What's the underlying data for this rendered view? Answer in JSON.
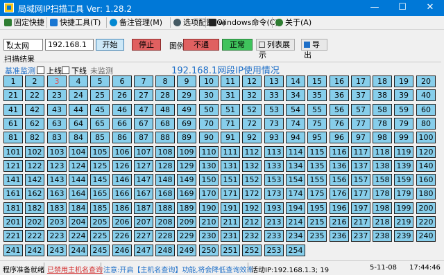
{
  "window": {
    "title": "局域网IP扫描工具  Ver: 1.28.2",
    "minimize": "—",
    "maximize": "☐",
    "close": "✕"
  },
  "menu": [
    {
      "label": "固定快捷",
      "icon": "pin-icon",
      "color": "#2e7d32"
    },
    {
      "label": "快捷工具(T)",
      "icon": "tools-icon",
      "color": "#1976d2"
    },
    {
      "label": "备注管理(M)",
      "icon": "comment-icon",
      "color": "#0288d1"
    },
    {
      "label": "选项配置(O)",
      "icon": "gear-icon",
      "color": "#455a64"
    },
    {
      "label": "windows命令(C)",
      "icon": "terminal-icon",
      "color": "#212121"
    },
    {
      "label": "关于(A)",
      "icon": "globe-icon",
      "color": "#2e7d32"
    }
  ],
  "toolbar": {
    "adapter": "以太网",
    "ip": "192.168.1",
    "start": "开始",
    "stop": "停止",
    "legend_label": "图例:",
    "legend_fail": "不通",
    "legend_ok": "正常",
    "list_view": "列表展示",
    "export": "导出"
  },
  "scan": {
    "group_title": "扫描结果",
    "tab_base": "基准监测",
    "online": "上线",
    "offline": "下线",
    "unmonitored": "未监测",
    "grid_title": "192.168.1网段IP使用情况",
    "cell_count": 254,
    "columns": 20,
    "highlight_ip": 3,
    "colors": {
      "cell": "#87ceeb",
      "highlight_text": "#e25050",
      "fail": "#e06060",
      "ok": "#3fc35c"
    }
  },
  "status": {
    "ready": "程序准备就绪",
    "hostname_disabled": "已禁用主机名查询",
    "hint": "注意:开启【主机名查询】功能,将会降低查询效率",
    "active_ip": "活动IP:192.168.1.3; 19",
    "date": "5-11-08",
    "time": "17:44:46"
  }
}
